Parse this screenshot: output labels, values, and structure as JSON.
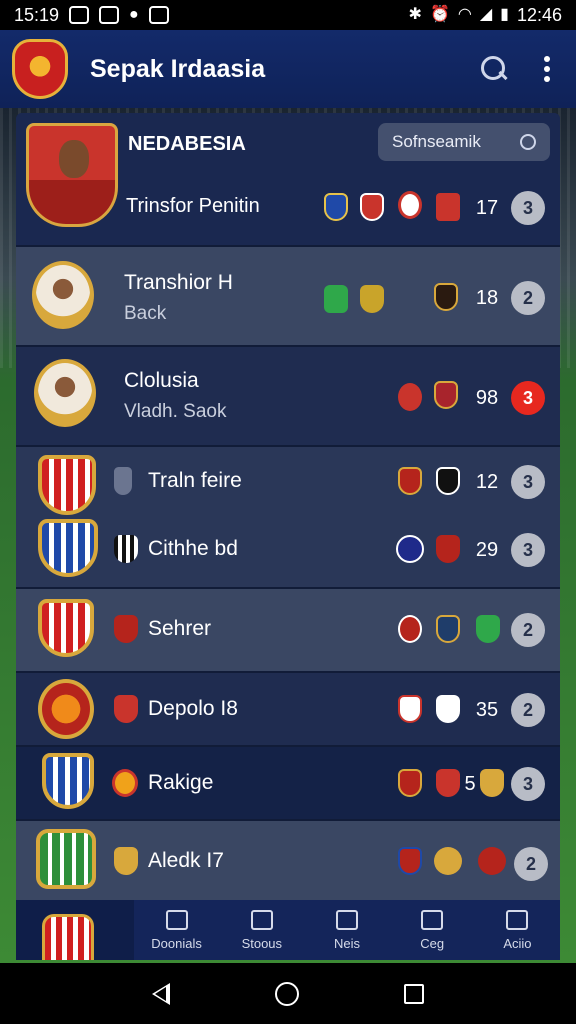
{
  "status_bar": {
    "time_left": "15:19",
    "time_right": "12:46"
  },
  "app": {
    "title": "Sepak Irdaasia"
  },
  "header": {
    "title": "NEDABESIA",
    "subtitle": "Trinsfor Penitin",
    "search_placeholder": "Sofnseamik",
    "number": "17",
    "badge": "3"
  },
  "rows": [
    {
      "name": "Transhior H",
      "sub": "Back",
      "number": "18",
      "badge": "2"
    },
    {
      "name": "Clolusia",
      "sub": "Vladh. Saok",
      "number": "98",
      "badge": "3"
    },
    {
      "name": "Traln feire",
      "sub": "",
      "number": "12",
      "badge": "3"
    },
    {
      "name": "Cithhe bd",
      "sub": "",
      "number": "29",
      "badge": "3"
    },
    {
      "name": "Sehrer",
      "sub": "",
      "number": "",
      "badge": "2"
    },
    {
      "name": "Depolo I8",
      "sub": "",
      "number": "35",
      "badge": "2"
    },
    {
      "name": "Rakige",
      "sub": "",
      "number": "5",
      "badge": "3"
    },
    {
      "name": "Aledk I7",
      "sub": "",
      "number": "",
      "badge": "2"
    }
  ],
  "bottom_nav": [
    "Doonials",
    "Stoous",
    "Neis",
    "Ceg",
    "Aciio"
  ],
  "colors": {
    "accent_red": "#e7281f",
    "panel": "#1c2a4e",
    "appbar": "#132a6a"
  }
}
